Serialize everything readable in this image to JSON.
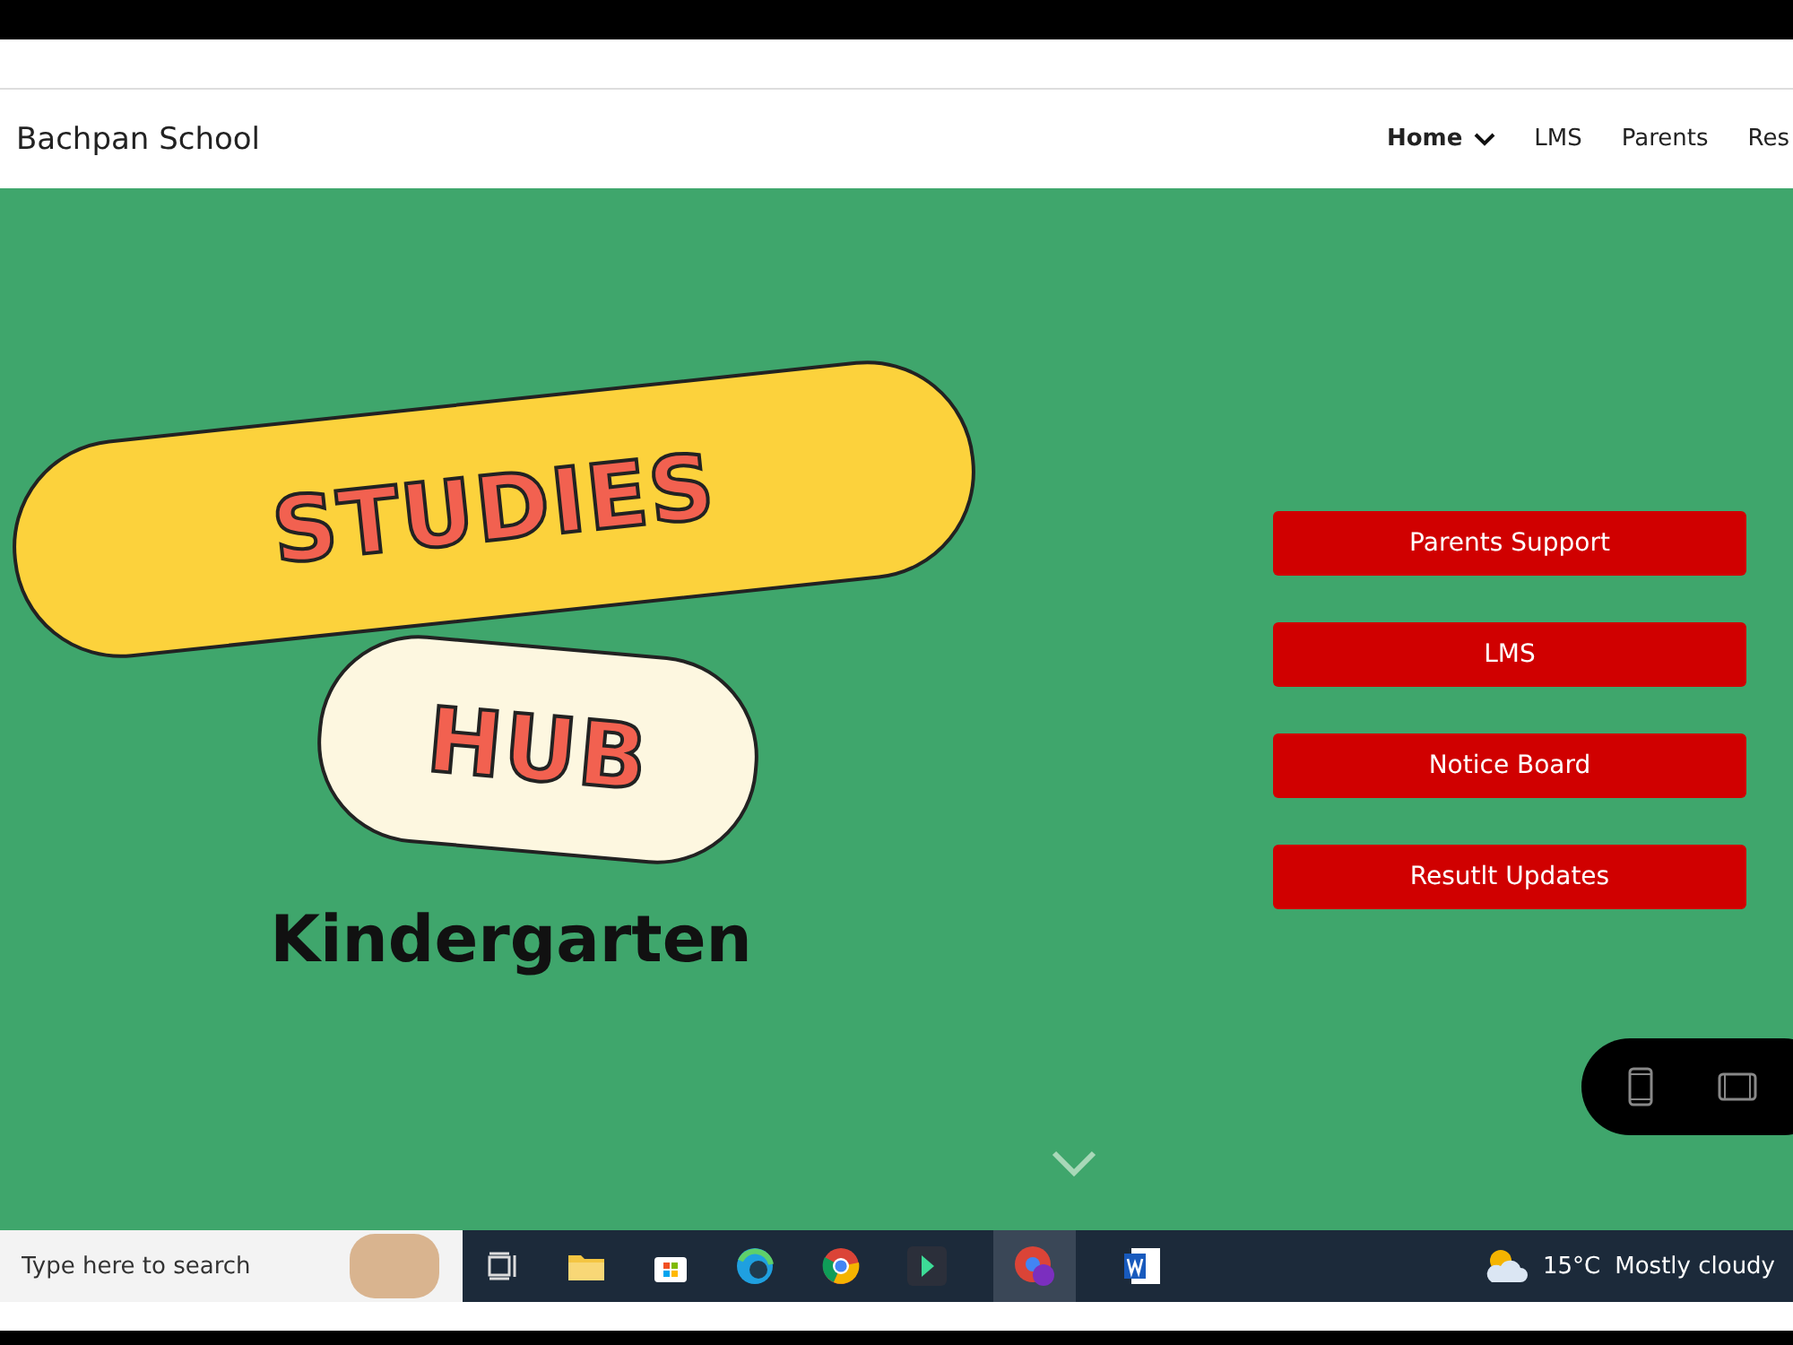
{
  "navbar": {
    "brand": "Bachpan School",
    "items": [
      {
        "label": "Home",
        "selected": true,
        "dropdown": true
      },
      {
        "label": "LMS",
        "selected": false,
        "dropdown": false
      },
      {
        "label": "Parents",
        "selected": false,
        "dropdown": false
      },
      {
        "label": "Res",
        "selected": false,
        "dropdown": false
      }
    ]
  },
  "hero": {
    "title_top": "STUDIES",
    "title_bottom": "HUB",
    "subtitle": "Kindergarten",
    "buttons": [
      "Parents Support",
      "LMS",
      "Notice Board",
      "Resutlt Updates"
    ]
  },
  "taskbar": {
    "search": {
      "placeholder": "Type here to search"
    },
    "weather": {
      "temperature": "15°C",
      "condition": "Mostly cloudy"
    }
  }
}
